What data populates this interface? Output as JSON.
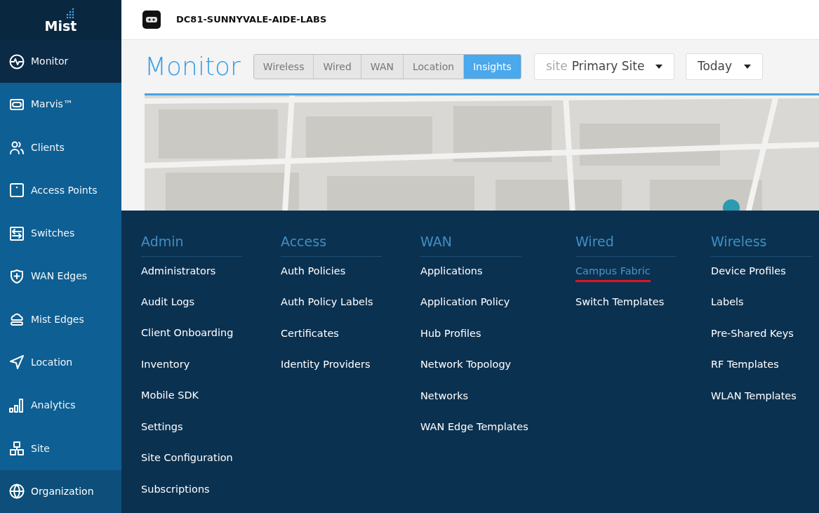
{
  "sidebar": {
    "logo": "Mist",
    "items": [
      {
        "label": "Monitor",
        "kind": "monitor",
        "selected": true,
        "hovered": false
      },
      {
        "label": "Marvis™",
        "kind": "marvis",
        "selected": false,
        "hovered": false
      },
      {
        "label": "Clients",
        "kind": "clients",
        "selected": false,
        "hovered": false
      },
      {
        "label": "Access Points",
        "kind": "ap",
        "selected": false,
        "hovered": false
      },
      {
        "label": "Switches",
        "kind": "switches",
        "selected": false,
        "hovered": false
      },
      {
        "label": "WAN Edges",
        "kind": "wan",
        "selected": false,
        "hovered": false
      },
      {
        "label": "Mist Edges",
        "kind": "mistedge",
        "selected": false,
        "hovered": false
      },
      {
        "label": "Location",
        "kind": "location",
        "selected": false,
        "hovered": false
      },
      {
        "label": "Analytics",
        "kind": "analytics",
        "selected": false,
        "hovered": false
      },
      {
        "label": "Site",
        "kind": "site",
        "selected": false,
        "hovered": false
      },
      {
        "label": "Organization",
        "kind": "org",
        "selected": false,
        "hovered": true
      }
    ]
  },
  "header": {
    "org_name": "DC81-SUNNYVALE-AIDE-LABS"
  },
  "toolbar": {
    "title": "Monitor",
    "tabs": [
      {
        "label": "Wireless",
        "selected": false
      },
      {
        "label": "Wired",
        "selected": false
      },
      {
        "label": "WAN",
        "selected": false
      },
      {
        "label": "Location",
        "selected": false
      },
      {
        "label": "Insights",
        "selected": true
      }
    ],
    "site_select": {
      "prefix": "site",
      "value": "Primary Site"
    },
    "period_select": {
      "value": "Today"
    }
  },
  "org_menu": {
    "columns": [
      {
        "heading": "Admin",
        "items": [
          {
            "label": "Administrators",
            "selected": false
          },
          {
            "label": "Audit Logs",
            "selected": false
          },
          {
            "label": "Client Onboarding",
            "selected": false
          },
          {
            "label": "Inventory",
            "selected": false
          },
          {
            "label": "Mobile SDK",
            "selected": false
          },
          {
            "label": "Settings",
            "selected": false
          },
          {
            "label": "Site Configuration",
            "selected": false
          },
          {
            "label": "Subscriptions",
            "selected": false
          }
        ]
      },
      {
        "heading": "Access",
        "items": [
          {
            "label": "Auth Policies",
            "selected": false
          },
          {
            "label": "Auth Policy Labels",
            "selected": false
          },
          {
            "label": "Certificates",
            "selected": false
          },
          {
            "label": "Identity Providers",
            "selected": false
          }
        ]
      },
      {
        "heading": "WAN",
        "items": [
          {
            "label": "Applications",
            "selected": false
          },
          {
            "label": "Application Policy",
            "selected": false
          },
          {
            "label": "Hub Profiles",
            "selected": false
          },
          {
            "label": "Network Topology",
            "selected": false
          },
          {
            "label": "Networks",
            "selected": false
          },
          {
            "label": "WAN Edge Templates",
            "selected": false
          }
        ]
      },
      {
        "heading": "Wired",
        "items": [
          {
            "label": "Campus Fabric",
            "selected": true
          },
          {
            "label": "Switch Templates",
            "selected": false
          }
        ]
      },
      {
        "heading": "Wireless",
        "items": [
          {
            "label": "Device Profiles",
            "selected": false
          },
          {
            "label": "Labels",
            "selected": false
          },
          {
            "label": "Pre-Shared Keys",
            "selected": false
          },
          {
            "label": "RF Templates",
            "selected": false
          },
          {
            "label": "WLAN Templates",
            "selected": false
          }
        ]
      }
    ]
  }
}
